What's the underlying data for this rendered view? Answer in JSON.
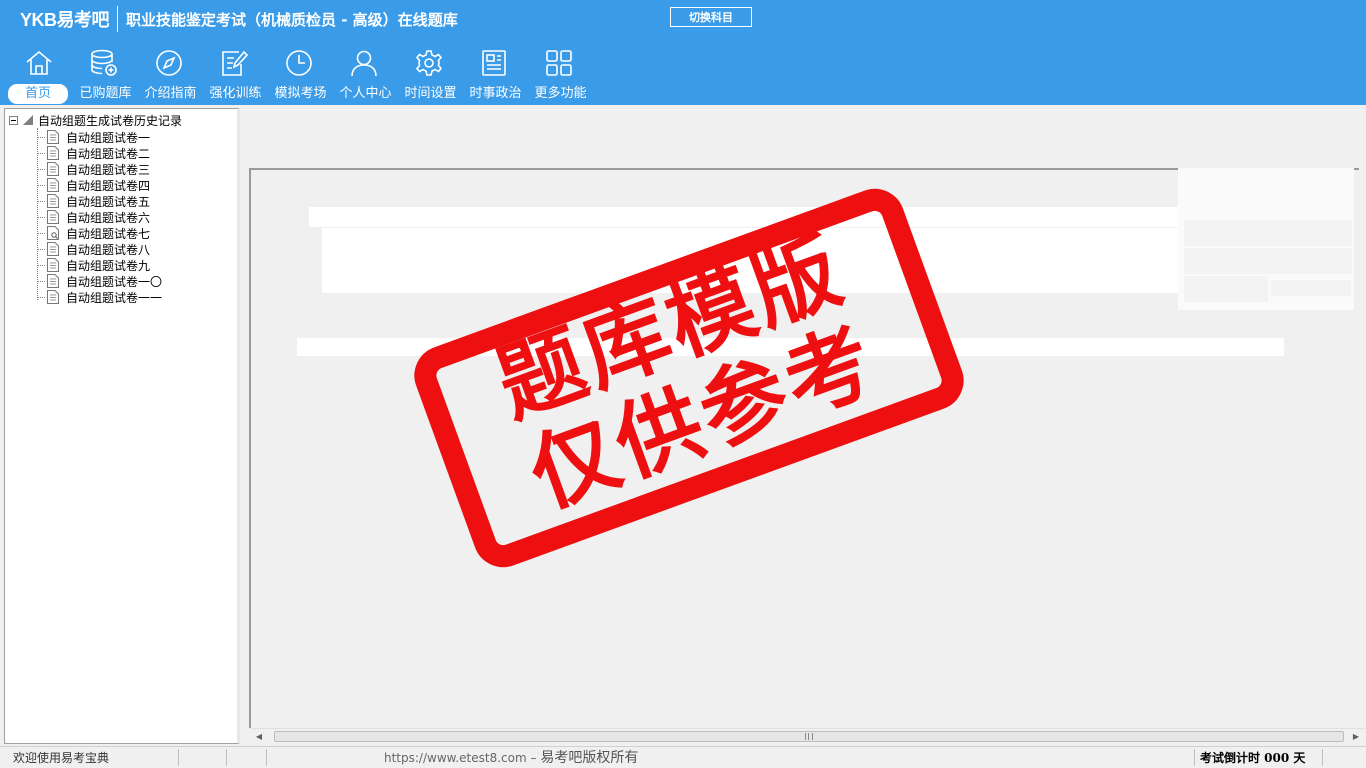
{
  "app": {
    "logo": "YKB易考吧",
    "title": "职业技能鉴定考试（机械质检员 - 高级）在线题库",
    "switch_subject": "切换科目"
  },
  "toolbar": [
    {
      "label": "首页",
      "icon": "home-icon",
      "active": true
    },
    {
      "label": "已购题库",
      "icon": "database-icon"
    },
    {
      "label": "介绍指南",
      "icon": "compass-icon"
    },
    {
      "label": "强化训练",
      "icon": "edit-icon"
    },
    {
      "label": "模拟考场",
      "icon": "clock-icon"
    },
    {
      "label": "个人中心",
      "icon": "user-icon"
    },
    {
      "label": "时间设置",
      "icon": "gear-icon"
    },
    {
      "label": "时事政治",
      "icon": "news-icon"
    },
    {
      "label": "更多功能",
      "icon": "grid-icon"
    }
  ],
  "tree": {
    "root": "自动组题生成试卷历史记录",
    "items": [
      "自动组题试卷一",
      "自动组题试卷二",
      "自动组题试卷三",
      "自动组题试卷四",
      "自动组题试卷五",
      "自动组题试卷六",
      "自动组题试卷七",
      "自动组题试卷八",
      "自动组题试卷九",
      "自动组题试卷一〇",
      "自动组题试卷一一"
    ]
  },
  "stamp": {
    "line1": "题库模版",
    "line2": "仅供参考"
  },
  "status": {
    "welcome": "欢迎使用易考宝典",
    "url": "https://www.etest8.com",
    "dash": " – ",
    "copyright": "易考吧版权所有",
    "countdown": "考试倒计时 000 天"
  },
  "colors": {
    "header_bg": "#3a9be8",
    "stamp_red": "#ee1010"
  }
}
